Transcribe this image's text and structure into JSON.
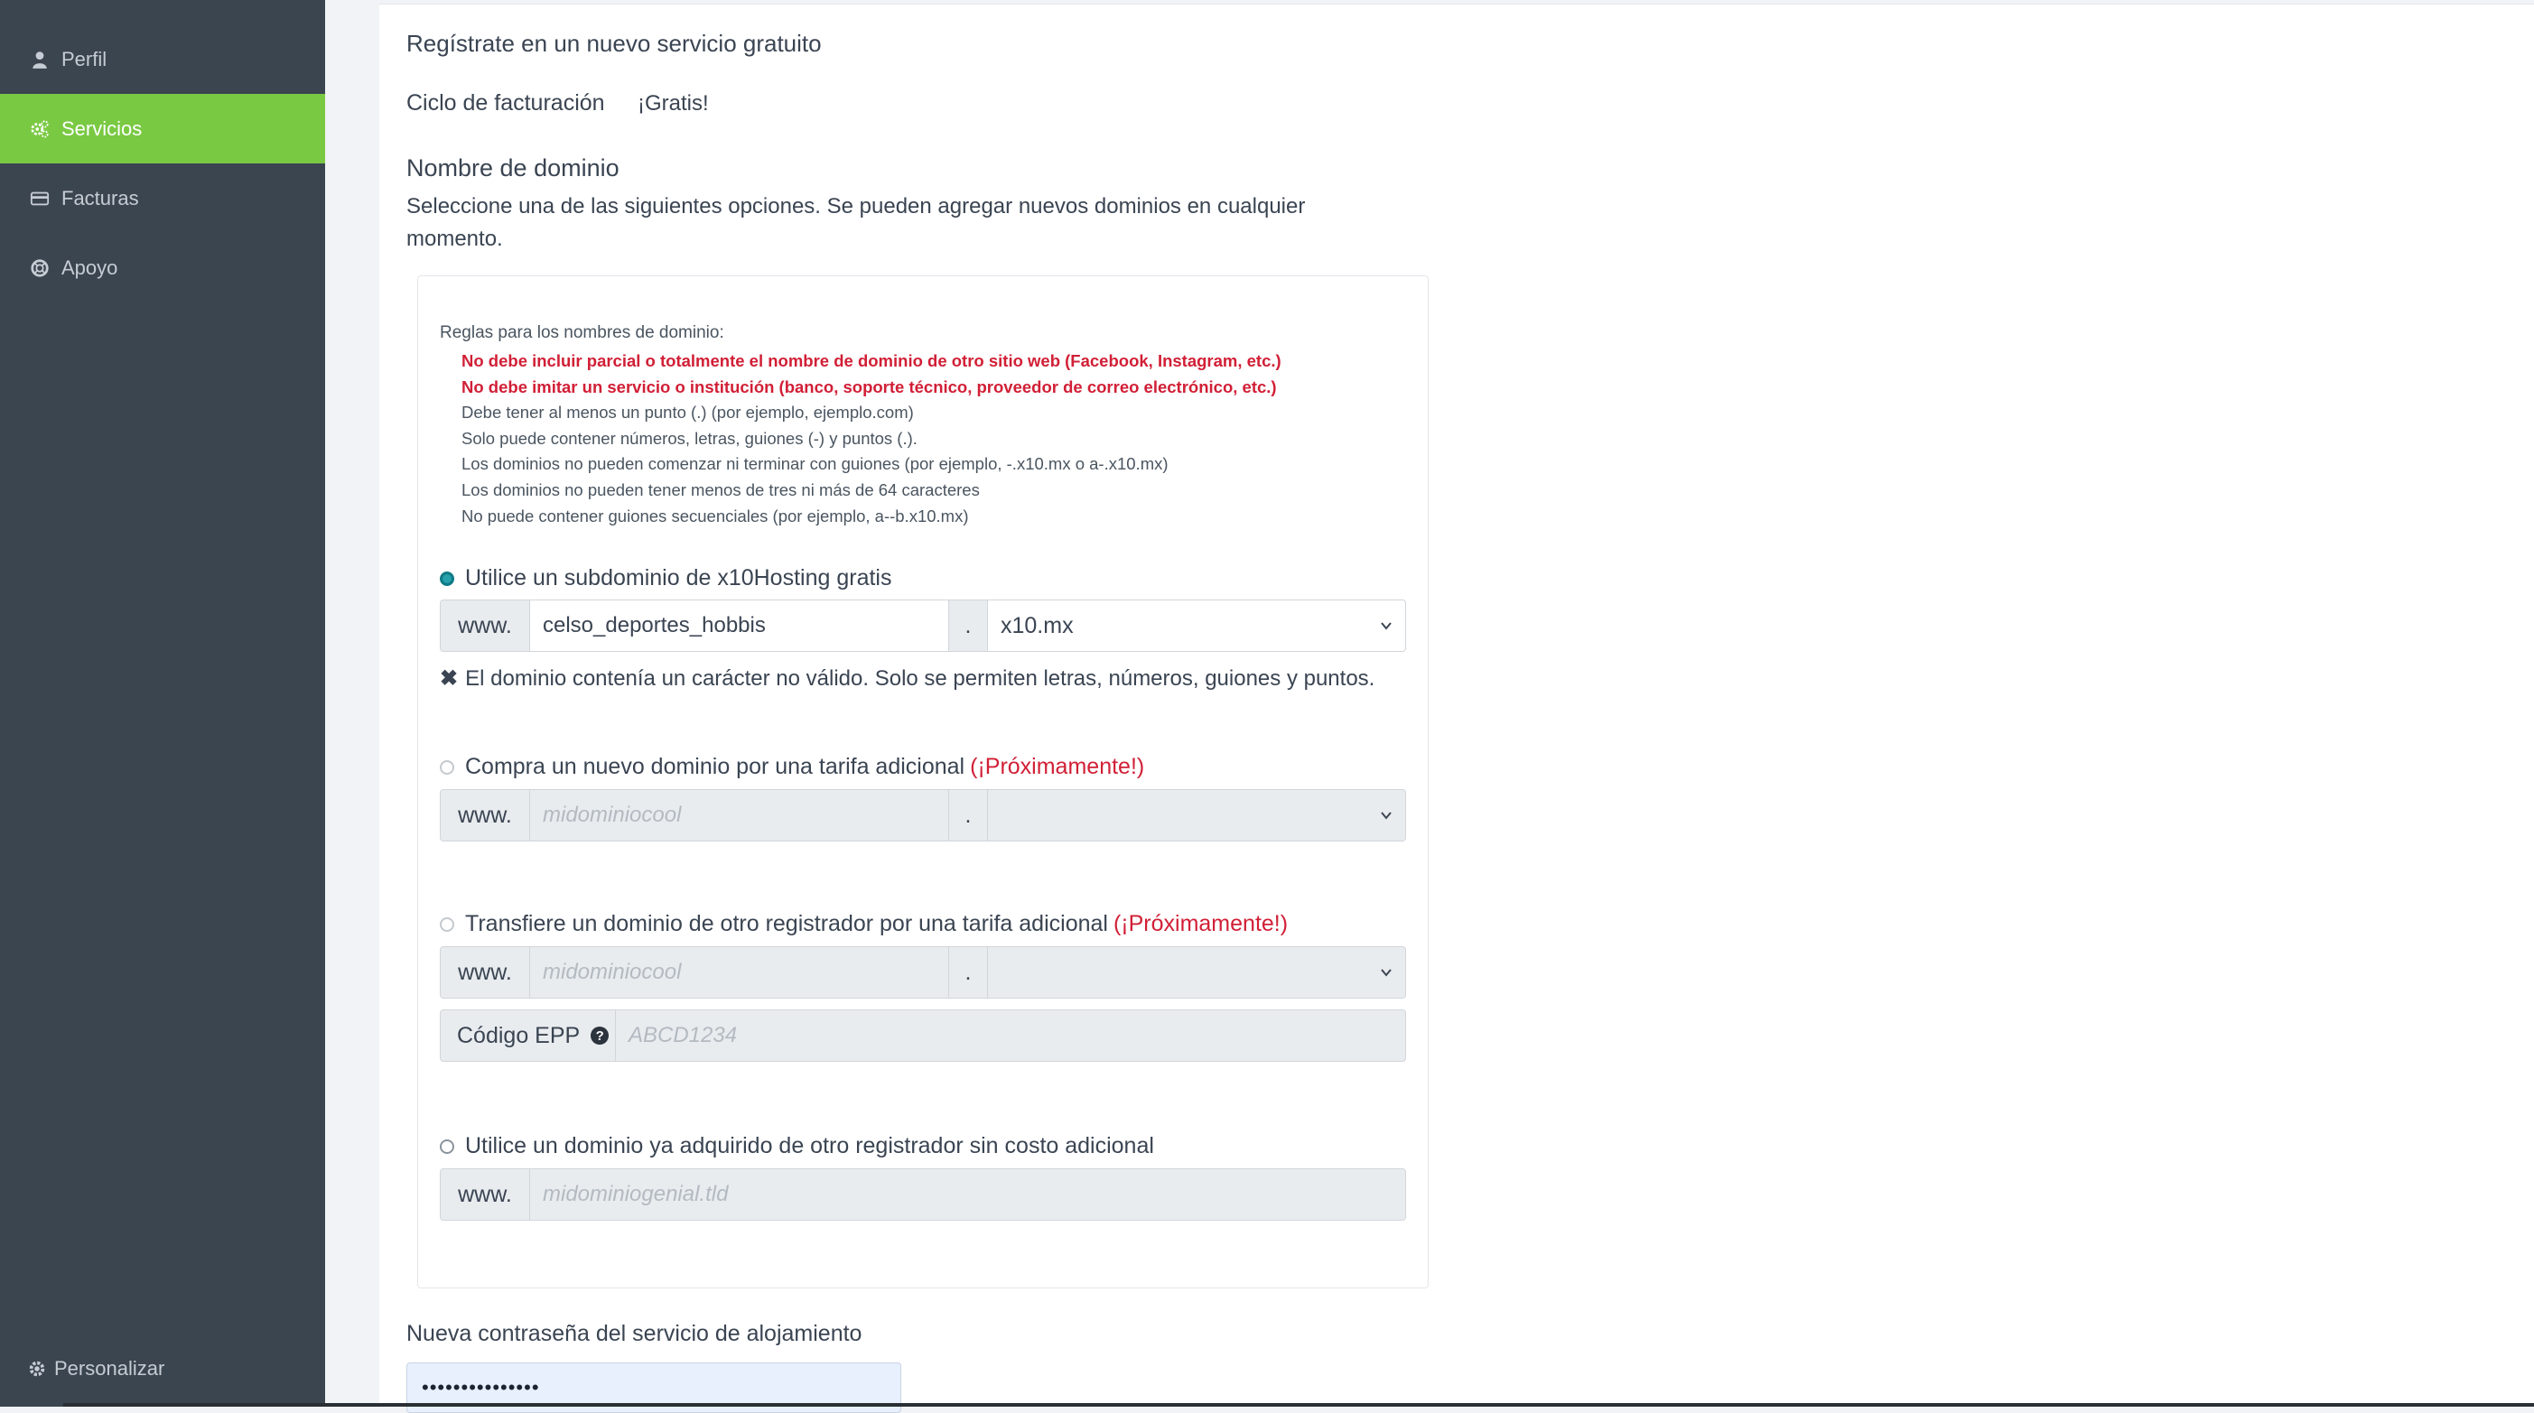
{
  "sidebar": {
    "items": [
      {
        "label": "Perfil",
        "icon": "user-icon"
      },
      {
        "label": "Servicios",
        "icon": "cogs-icon"
      },
      {
        "label": "Facturas",
        "icon": "credit-card-icon"
      },
      {
        "label": "Apoyo",
        "icon": "life-ring-icon"
      }
    ],
    "customize": "Personalizar",
    "active_color": "#7ac943"
  },
  "page": {
    "title": "Regístrate en un nuevo servicio gratuito",
    "billing_label": "Ciclo de facturación",
    "billing_value": "¡Gratis!",
    "domain_heading": "Nombre de dominio",
    "domain_description": "Seleccione una de las siguientes opciones. Se pueden agregar nuevos dominios en cualquier momento."
  },
  "rules": {
    "title": "Reglas para los nombres de dominio:",
    "warnings": [
      "No debe incluir parcial o totalmente el nombre de dominio de otro sitio web (Facebook, Instagram, etc.)",
      "No debe imitar un servicio o institución (banco, soporte técnico, proveedor de correo electrónico, etc.)"
    ],
    "items": [
      "Debe tener al menos un punto (.) (por ejemplo, ejemplo.com)",
      "Solo puede contener números, letras, guiones (-) y puntos (.).",
      "Los dominios no pueden comenzar ni terminar con guiones (por ejemplo, -.x10.mx o a-.x10.mx)",
      "Los dominios no pueden tener menos de tres ni más de 64 caracteres",
      "No puede contener guiones secuenciales (por ejemplo, a--b.x10.mx)"
    ]
  },
  "options": {
    "subdomain": {
      "label": "Utilice un subdominio de x10Hosting gratis",
      "prefix": "www.",
      "value": "celso_deportes_hobbis",
      "dot": ".",
      "tld": "x10.mx",
      "error": "El dominio contenía un carácter no válido. Solo se permiten letras, números, guiones y puntos."
    },
    "purchase": {
      "label": "Compra un nuevo dominio por una tarifa adicional",
      "soon": "(¡Próximamente!)",
      "prefix": "www.",
      "placeholder": "midominiocool",
      "dot": "."
    },
    "transfer": {
      "label": "Transfiere un dominio de otro registrador por una tarifa adicional",
      "soon": "(¡Próximamente!)",
      "prefix": "www.",
      "placeholder": "midominiocool",
      "dot": ".",
      "epp_label": "Código EPP",
      "epp_placeholder": "ABCD1234"
    },
    "existing": {
      "label": "Utilice un dominio ya adquirido de otro registrador sin costo adicional",
      "prefix": "www.",
      "placeholder": "midominiogenial.tld"
    }
  },
  "password": {
    "label": "Nueva contraseña del servicio de alojamiento",
    "value": "•••••••••••••••"
  }
}
